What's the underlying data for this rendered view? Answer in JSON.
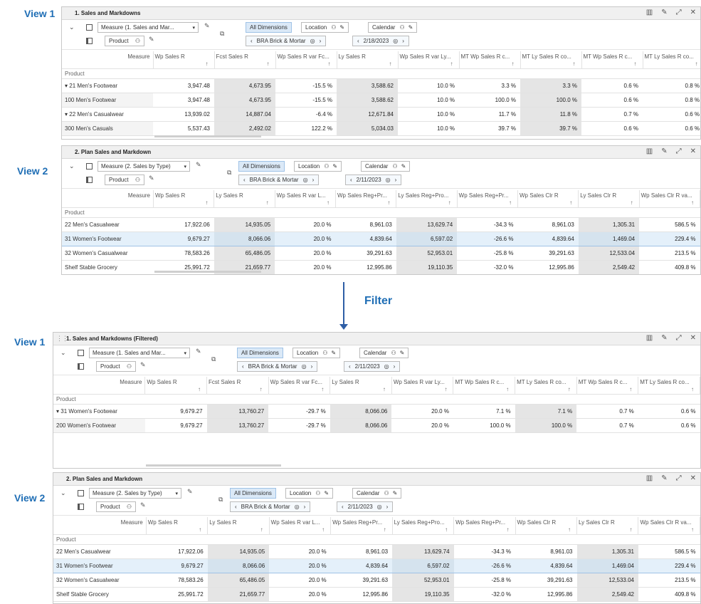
{
  "labels": {
    "view1": "View 1",
    "view2": "View 2",
    "filter": "Filter"
  },
  "common": {
    "measure1": "Measure (1. Sales and Mar...",
    "measure2": "Measure (2. Sales by Type)",
    "all_dimensions": "All Dimensions",
    "location": "Location",
    "calendar": "Calendar",
    "product": "Product",
    "brick": "BRA Brick & Mortar",
    "measure_hdr": "Measure",
    "product_hdr": "Product"
  },
  "top": {
    "view1": {
      "title": "1. Sales and Markdowns",
      "date": "2/18/2023",
      "columns": [
        "Wp Sales R",
        "Fcst Sales R",
        "Wp Sales R var Fc...",
        "Ly Sales R",
        "Wp Sales R var Ly...",
        "MT Wp Sales R c...",
        "MT Ly Sales R co...",
        "MT Wp Sales R c...",
        "MT Ly Sales R co..."
      ],
      "rows": [
        {
          "label": "▾ 21 Men's Footwear",
          "cells": [
            "3,947.48",
            "4,673.95",
            "-15.5 %",
            "3,588.62",
            "10.0 %",
            "3.3 %",
            "3.3 %",
            "0.6 %",
            "0.8 %"
          ]
        },
        {
          "label": "100 Men's Footwear",
          "cells": [
            "3,947.48",
            "4,673.95",
            "-15.5 %",
            "3,588.62",
            "10.0 %",
            "100.0 %",
            "100.0 %",
            "0.6 %",
            "0.8 %"
          ]
        },
        {
          "label": "▾ 22 Men's Casualwear",
          "cells": [
            "13,939.02",
            "14,887.04",
            "-6.4 %",
            "12,671.84",
            "10.0 %",
            "11.7 %",
            "11.8 %",
            "0.7 %",
            "0.6 %"
          ]
        },
        {
          "label": "300 Men's Casuals",
          "cells": [
            "5,537.43",
            "2,492.02",
            "122.2 %",
            "5,034.03",
            "10.0 %",
            "39.7 %",
            "39.7 %",
            "0.6 %",
            "0.6 %"
          ]
        }
      ]
    },
    "view2": {
      "title": "2. Plan Sales and Markdown",
      "date": "2/11/2023",
      "columns": [
        "Wp Sales R",
        "Ly Sales R",
        "Wp Sales R var L...",
        "Wp Sales Reg+Pr...",
        "Ly Sales Reg+Pro...",
        "Wp Sales Reg+Pr...",
        "Wp Sales Clr R",
        "Ly Sales Clr R",
        "Wp Sales Clr R va..."
      ],
      "rows": [
        {
          "label": "22 Men's Casualwear",
          "cells": [
            "17,922.06",
            "14,935.05",
            "20.0 %",
            "8,961.03",
            "13,629.74",
            "-34.3 %",
            "8,961.03",
            "1,305.31",
            "586.5 %"
          ]
        },
        {
          "label": "31 Women's Footwear",
          "cells": [
            "9,679.27",
            "8,066.06",
            "20.0 %",
            "4,839.64",
            "6,597.02",
            "-26.6 %",
            "4,839.64",
            "1,469.04",
            "229.4 %"
          ]
        },
        {
          "label": "32 Women's Casualwear",
          "cells": [
            "78,583.26",
            "65,486.05",
            "20.0 %",
            "39,291.63",
            "52,953.01",
            "-25.8 %",
            "39,291.63",
            "12,533.04",
            "213.5 %"
          ]
        },
        {
          "label": "Shelf Stable Grocery",
          "cells": [
            "25,991.72",
            "21,659.77",
            "20.0 %",
            "12,995.86",
            "19,110.35",
            "-32.0 %",
            "12,995.86",
            "2,549.42",
            "409.8 %"
          ]
        }
      ]
    }
  },
  "bottom": {
    "view1": {
      "title": "1. Sales and Markdowns (Filtered)",
      "date": "2/11/2023",
      "columns": [
        "Wp Sales R",
        "Fcst Sales R",
        "Wp Sales R var Fc...",
        "Ly Sales R",
        "Wp Sales R var Ly...",
        "MT Wp Sales R c...",
        "MT Ly Sales R co...",
        "MT Wp Sales R c...",
        "MT Ly Sales R co..."
      ],
      "rows": [
        {
          "label": "▾ 31 Women's Footwear",
          "cells": [
            "9,679.27",
            "13,760.27",
            "-29.7 %",
            "8,066.06",
            "20.0 %",
            "7.1 %",
            "7.1 %",
            "0.7 %",
            "0.6 %"
          ]
        },
        {
          "label": "200 Women's Footwear",
          "cells": [
            "9,679.27",
            "13,760.27",
            "-29.7 %",
            "8,066.06",
            "20.0 %",
            "100.0 %",
            "100.0 %",
            "0.7 %",
            "0.6 %"
          ]
        }
      ]
    },
    "view2": {
      "title": "2. Plan Sales and Markdown",
      "date": "2/11/2023",
      "columns": [
        "Wp Sales R",
        "Ly Sales R",
        "Wp Sales R var L...",
        "Wp Sales Reg+Pr...",
        "Ly Sales Reg+Pro...",
        "Wp Sales Reg+Pr...",
        "Wp Sales Clr R",
        "Ly Sales Clr R",
        "Wp Sales Clr R va..."
      ],
      "rows": [
        {
          "label": "22 Men's Casualwear",
          "cells": [
            "17,922.06",
            "14,935.05",
            "20.0 %",
            "8,961.03",
            "13,629.74",
            "-34.3 %",
            "8,961.03",
            "1,305.31",
            "586.5 %"
          ]
        },
        {
          "label": "31 Women's Footwear",
          "cells": [
            "9,679.27",
            "8,066.06",
            "20.0 %",
            "4,839.64",
            "6,597.02",
            "-26.6 %",
            "4,839.64",
            "1,469.04",
            "229.4 %"
          ]
        },
        {
          "label": "32 Women's Casualwear",
          "cells": [
            "78,583.26",
            "65,486.05",
            "20.0 %",
            "39,291.63",
            "52,953.01",
            "-25.8 %",
            "39,291.63",
            "12,533.04",
            "213.5 %"
          ]
        },
        {
          "label": "Shelf Stable Grocery",
          "cells": [
            "25,991.72",
            "21,659.77",
            "20.0 %",
            "12,995.86",
            "19,110.35",
            "-32.0 %",
            "12,995.86",
            "2,549.42",
            "409.8 %"
          ]
        }
      ]
    }
  },
  "icons": [
    "bar-chart-icon",
    "pencil-icon",
    "expand-icon",
    "close-icon",
    "hierarchy-icon",
    "target-icon",
    "chevron-down-icon",
    "pivot-icon"
  ]
}
